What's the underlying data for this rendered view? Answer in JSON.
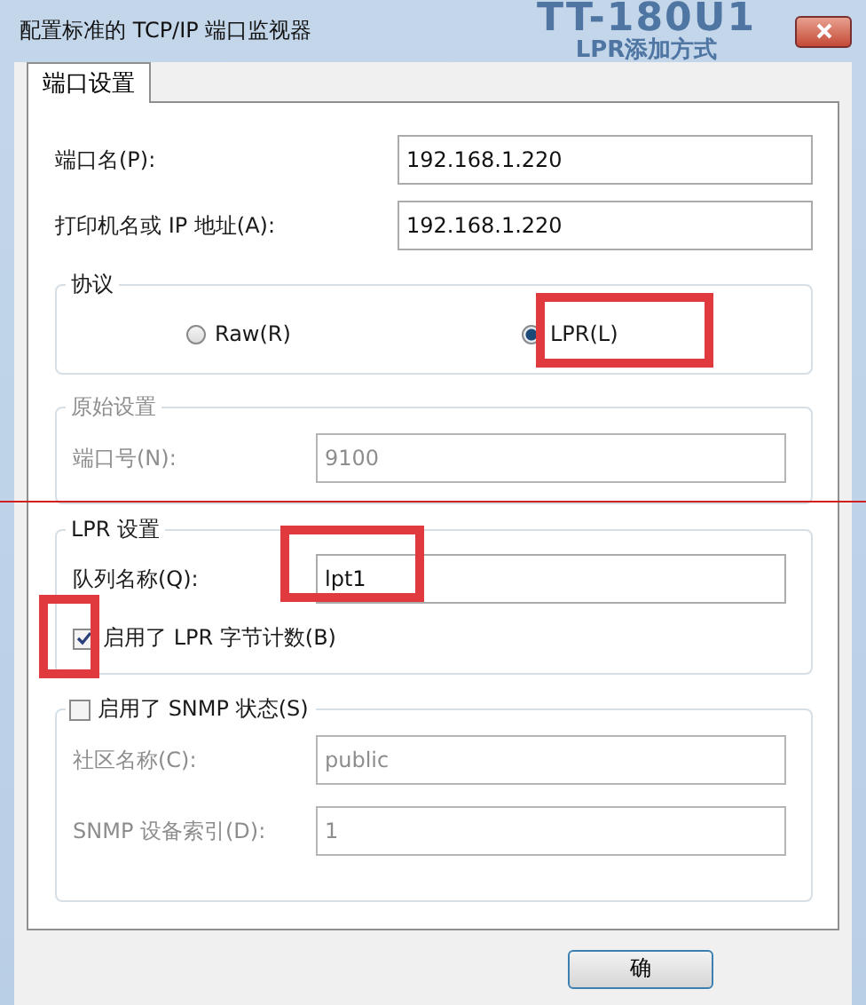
{
  "window": {
    "title": "配置标准的 TCP/IP 端口监视器"
  },
  "caption": [
    "TT-180U1",
    "LPR添加方式"
  ],
  "tabs": [
    {
      "label": "端口设置",
      "selected": true
    }
  ],
  "port_name": {
    "label": "端口名(P):",
    "value": "192.168.1.220"
  },
  "printer_address": {
    "label": "打印机名或 IP 地址(A):",
    "value": "192.168.1.220"
  },
  "protocol": {
    "title": "协议",
    "options": [
      {
        "label": "Raw(R)",
        "selected": false
      },
      {
        "label": "LPR(L)",
        "selected": true
      }
    ]
  },
  "raw_settings": {
    "title": "原始设置",
    "disabled": true,
    "port_number": {
      "label": "端口号(N):",
      "value": "9100"
    }
  },
  "lpr_settings": {
    "title": "LPR 设置",
    "queue_name": {
      "label": "队列名称(Q):",
      "value": "lpt1"
    },
    "byte_counting": {
      "label": "启用了 LPR 字节计数(B)",
      "checked": true
    }
  },
  "snmp": {
    "label": "启用了 SNMP 状态(S)",
    "checked": false,
    "community": {
      "label": "社区名称(C):",
      "value": "public"
    },
    "device_index": {
      "label": "SNMP 设备索引(D):",
      "value": "1"
    }
  },
  "buttons": [
    "确"
  ]
}
